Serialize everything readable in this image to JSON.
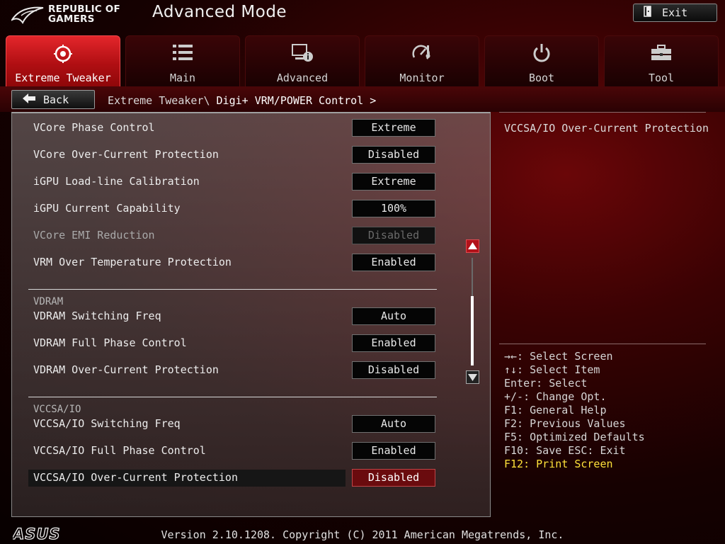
{
  "header": {
    "logo_line1": "REPUBLIC OF",
    "logo_line2": "GAMERS",
    "mode_title": "Advanced Mode",
    "exit_label": "Exit"
  },
  "tabs": [
    {
      "label": "Extreme Tweaker",
      "icon": "tweaker-icon",
      "active": true
    },
    {
      "label": "Main",
      "icon": "list-icon"
    },
    {
      "label": "Advanced",
      "icon": "advanced-settings-icon"
    },
    {
      "label": "Monitor",
      "icon": "monitor-gauge-icon"
    },
    {
      "label": "Boot",
      "icon": "power-icon"
    },
    {
      "label": "Tool",
      "icon": "toolbox-icon"
    }
  ],
  "subbar": {
    "back_label": "Back",
    "breadcrumb_parent": "Extreme Tweaker\\",
    "breadcrumb_current": "Digi+ VRM/POWER Control >"
  },
  "settings": [
    {
      "label": "VCore Phase Control",
      "value": "Extreme"
    },
    {
      "label": "VCore Over-Current Protection",
      "value": "Disabled"
    },
    {
      "label": "iGPU Load-line Calibration",
      "value": "Extreme"
    },
    {
      "label": "iGPU Current Capability",
      "value": "100%"
    },
    {
      "label": "VCore EMI Reduction",
      "value": "Disabled",
      "disabled": true
    },
    {
      "label": "VRM Over Temperature Protection",
      "value": "Enabled"
    },
    {
      "label": "VDRAM Switching Freq",
      "value": "Auto"
    },
    {
      "label": "VDRAM Full Phase Control",
      "value": "Enabled"
    },
    {
      "label": "VDRAM Over-Current Protection",
      "value": "Disabled"
    },
    {
      "label": "VCCSA/IO Switching Freq",
      "value": "Auto"
    },
    {
      "label": "VCCSA/IO Full Phase Control",
      "value": "Enabled"
    },
    {
      "label": "VCCSA/IO Over-Current Protection",
      "value": "Disabled",
      "selected": true
    }
  ],
  "sections": {
    "vdram": "VDRAM",
    "vccsa": "VCCSA/IO"
  },
  "help": {
    "title": "VCCSA/IO Over-Current Protection",
    "keys": [
      "→←: Select Screen",
      "↑↓: Select Item",
      "Enter: Select",
      "+/-: Change Opt.",
      "F1: General Help",
      "F2: Previous Values",
      "F5: Optimized Defaults",
      "F10: Save  ESC: Exit",
      "F12: Print Screen"
    ]
  },
  "footer": {
    "brand": "ASUS",
    "version": "Version 2.10.1208. Copyright (C) 2011 American Megatrends, Inc."
  },
  "colors": {
    "accent_red": "#b10f13",
    "highlight_yellow": "#ffe23a"
  }
}
